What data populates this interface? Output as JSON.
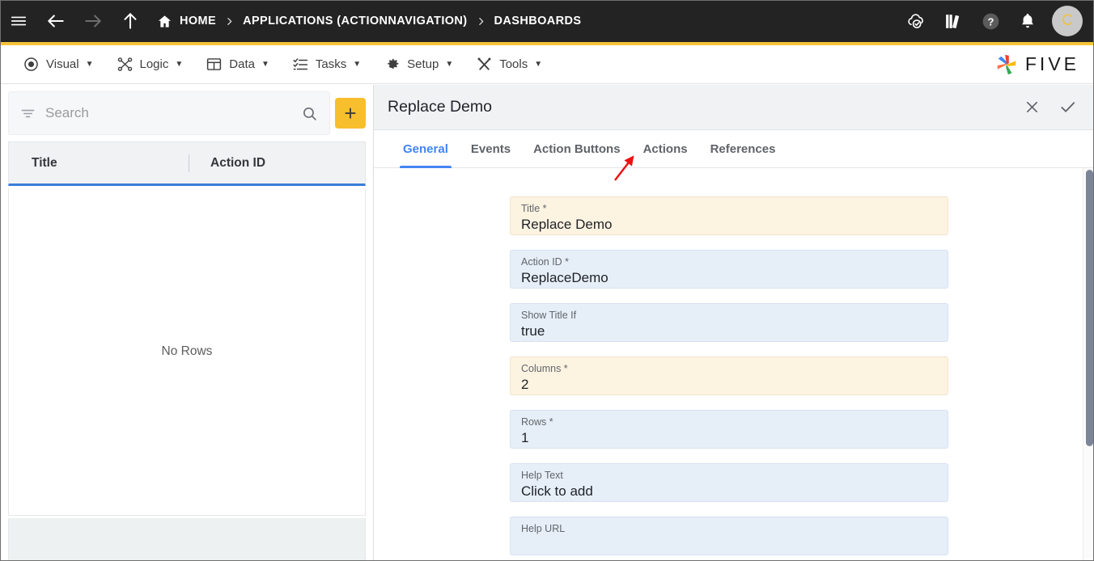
{
  "topbar": {
    "nav_icons": [
      {
        "name": "hamburger-menu-icon",
        "enabled": true
      },
      {
        "name": "back-arrow-icon",
        "enabled": true
      },
      {
        "name": "forward-arrow-icon",
        "enabled": false
      },
      {
        "name": "up-arrow-icon",
        "enabled": true
      }
    ],
    "breadcrumbs": [
      {
        "label": "HOME",
        "icon": "home-icon"
      },
      {
        "label": "APPLICATIONS (ACTIONNAVIGATION)",
        "icon": ""
      },
      {
        "label": "DASHBOARDS",
        "icon": ""
      }
    ],
    "separator": "›",
    "right_icons": [
      {
        "name": "cloud-check-icon"
      },
      {
        "name": "library-books-icon"
      },
      {
        "name": "help-icon"
      },
      {
        "name": "notifications-bell-icon"
      }
    ],
    "avatar_initial": "C",
    "background_color": "#232323",
    "accent_color": "#f5c33b"
  },
  "menubar": {
    "items": [
      {
        "label": "Visual",
        "icon": "eye-icon",
        "caret": "▼"
      },
      {
        "label": "Logic",
        "icon": "logic-nodes-icon",
        "caret": "▼"
      },
      {
        "label": "Data",
        "icon": "grid-table-icon",
        "caret": "▼"
      },
      {
        "label": "Tasks",
        "icon": "checklist-icon",
        "caret": "▼"
      },
      {
        "label": "Setup",
        "icon": "gear-icon",
        "caret": "▼"
      },
      {
        "label": "Tools",
        "icon": "tools-wrench-icon",
        "caret": "▼"
      }
    ],
    "brand": {
      "text": "FIVE",
      "icon": "five-pinwheel-logo-icon"
    }
  },
  "left_panel": {
    "search": {
      "placeholder": "Search",
      "value": "",
      "filter_icon": "filter-icon",
      "search_icon": "search-icon"
    },
    "add_button": {
      "label": "+",
      "color": "#f7be2d"
    },
    "table": {
      "columns": [
        "Title",
        "Action ID"
      ],
      "rows": [],
      "empty_message": "No Rows",
      "header_underline_color": "#3b7dd8"
    }
  },
  "right_panel": {
    "title": "Replace Demo",
    "header_actions": [
      {
        "name": "close-icon",
        "label": "✕"
      },
      {
        "name": "confirm-check-icon",
        "label": "✓"
      }
    ],
    "tabs": [
      {
        "label": "General",
        "active": true
      },
      {
        "label": "Events",
        "active": false
      },
      {
        "label": "Action Buttons",
        "active": false
      },
      {
        "label": "Actions",
        "active": false
      },
      {
        "label": "References",
        "active": false
      }
    ],
    "active_tab_color": "#4285f4",
    "fields": [
      {
        "label": "Title *",
        "value": "Replace Demo",
        "required": true
      },
      {
        "label": "Action ID *",
        "value": "ReplaceDemo",
        "required": true
      },
      {
        "label": "Show Title If",
        "value": "true",
        "required": false
      },
      {
        "label": "Columns *",
        "value": "2",
        "required": true
      },
      {
        "label": "Rows *",
        "value": "1",
        "required": false
      },
      {
        "label": "Help Text",
        "value": "Click to add",
        "required": false
      },
      {
        "label": "Help URL",
        "value": "",
        "required": false
      }
    ],
    "scrollbar": {
      "thumb_color": "#7c8598"
    }
  },
  "annotation": {
    "arrow": {
      "color": "#ee1111",
      "points_to": "Actions"
    }
  }
}
